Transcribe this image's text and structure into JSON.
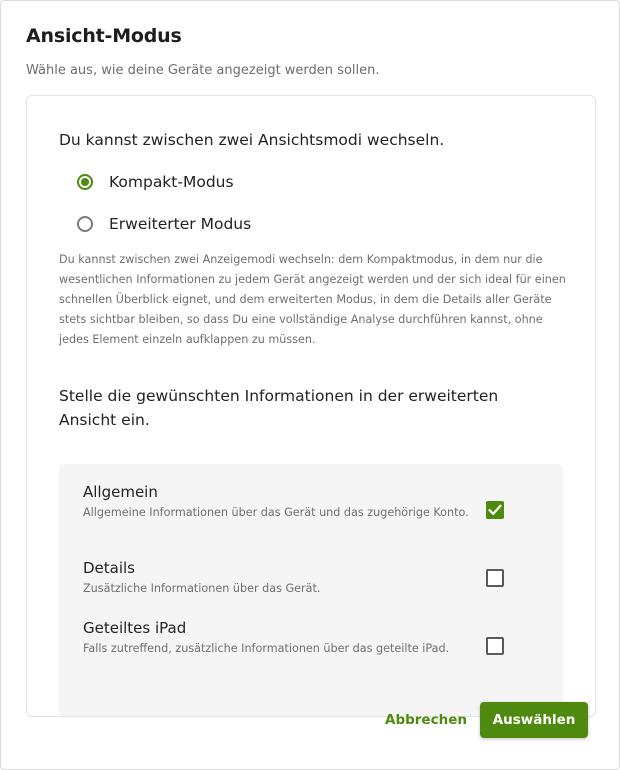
{
  "dialog": {
    "title": "Ansicht-Modus",
    "subtitle": "Wähle aus, wie deine Geräte angezeigt werden sollen."
  },
  "mode_section": {
    "heading": "Du kannst zwischen zwei Ansichtsmodi wechseln.",
    "options": [
      {
        "label": "Kompakt-Modus",
        "selected": true
      },
      {
        "label": "Erweiterter Modus",
        "selected": false
      }
    ],
    "description": "Du kannst zwischen zwei Anzeigemodi wechseln: dem Kompaktmodus, in dem nur die wesentlichen Informationen zu jedem Gerät angezeigt werden und der sich ideal für einen schnellen Überblick eignet, und dem erweiterten Modus, in dem die Details aller Geräte stets sichtbar bleiben, so dass Du eine vollständige Analyse durchführen kannst, ohne jedes Element einzeln aufklappen zu müssen."
  },
  "info_section": {
    "heading": "Stelle die gewünschten Informationen in der erweiterten Ansicht ein.",
    "items": [
      {
        "title": "Allgemein",
        "description": "Allgemeine Informationen über das Gerät und das zugehörige Konto.",
        "checked": true
      },
      {
        "title": "Details",
        "description": "Zusätzliche Informationen über das Gerät.",
        "checked": false
      },
      {
        "title": "Geteiltes iPad",
        "description": "Falls zutreffend, zusätzliche Informationen über das geteilte iPad.",
        "checked": false
      }
    ]
  },
  "footer": {
    "cancel_label": "Abbrechen",
    "select_label": "Auswählen"
  },
  "colors": {
    "accent": "#4d8a0f",
    "panel": "#f5f5f5"
  }
}
